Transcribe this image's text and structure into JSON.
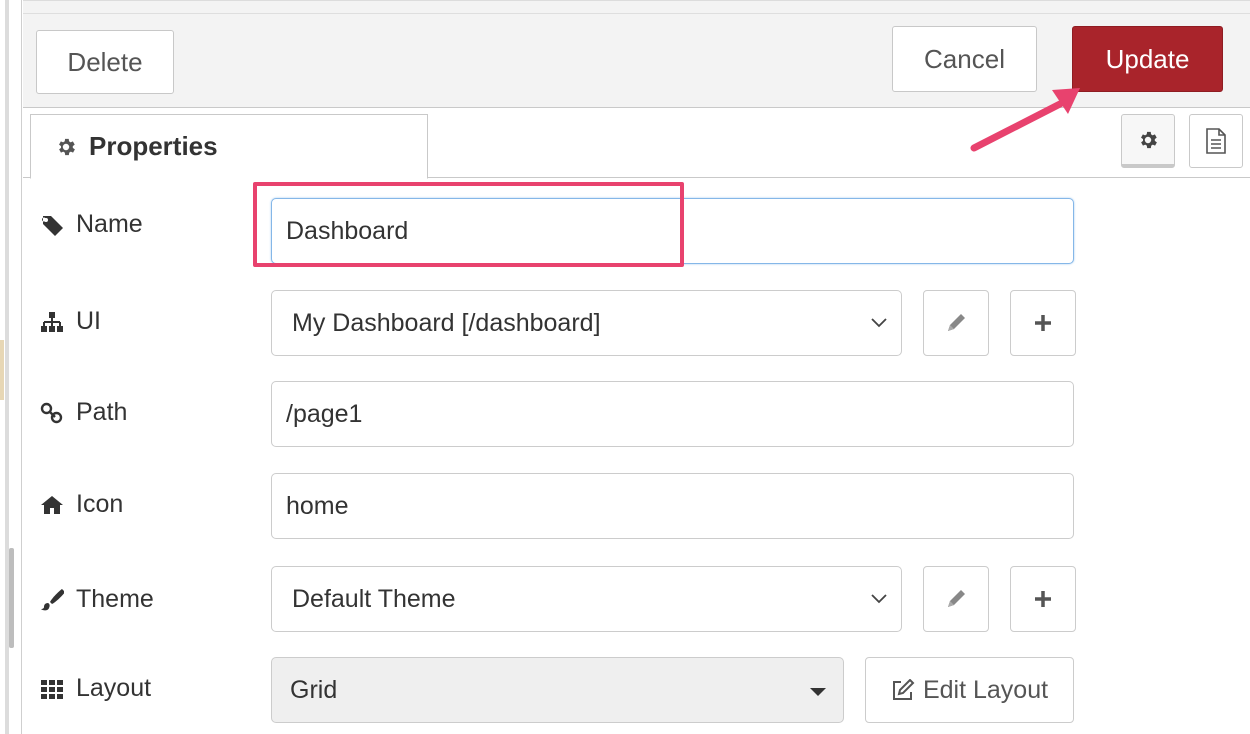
{
  "toolbar": {
    "delete_label": "Delete",
    "cancel_label": "Cancel",
    "update_label": "Update",
    "update_color": "#a9242b"
  },
  "tabs": {
    "properties_label": "Properties",
    "icons": [
      "gear-icon",
      "document-icon"
    ]
  },
  "form": {
    "name": {
      "label": "Name",
      "icon": "tag-icon",
      "value": "Dashboard"
    },
    "ui": {
      "label": "UI",
      "icon": "sitemap-icon",
      "value": "My Dashboard [/dashboard]"
    },
    "path": {
      "label": "Path",
      "icon": "link-icon",
      "value": "/page1"
    },
    "icon_field": {
      "label": "Icon",
      "icon": "home-icon",
      "value": "home"
    },
    "theme": {
      "label": "Theme",
      "icon": "paintbrush-icon",
      "value": "Default Theme"
    },
    "layout": {
      "label": "Layout",
      "icon": "grid-icon",
      "value": "Grid",
      "edit_button_label": "Edit Layout"
    }
  },
  "annotation": {
    "highlight_color": "#e8426e"
  }
}
